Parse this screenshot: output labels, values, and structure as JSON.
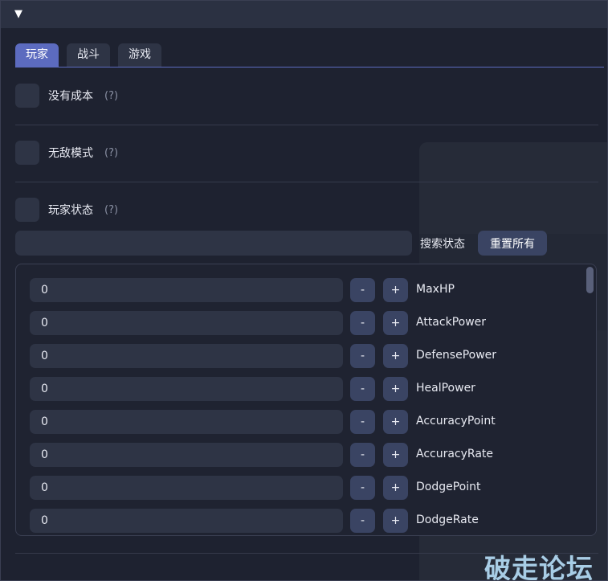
{
  "window": {
    "collapse_glyph": "▼"
  },
  "tabs": [
    {
      "label": "玩家",
      "active": true
    },
    {
      "label": "战斗",
      "active": false
    },
    {
      "label": "游戏",
      "active": false
    }
  ],
  "options": [
    {
      "label": "没有成本",
      "help": "(?)"
    },
    {
      "label": "无敌模式",
      "help": "(?)"
    },
    {
      "label": "玩家状态",
      "help": "(?)"
    }
  ],
  "search": {
    "value": "",
    "label": "搜索状态",
    "reset_label": "重置所有"
  },
  "stats": [
    {
      "value": "0",
      "name": "MaxHP"
    },
    {
      "value": "0",
      "name": "AttackPower"
    },
    {
      "value": "0",
      "name": "DefensePower"
    },
    {
      "value": "0",
      "name": "HealPower"
    },
    {
      "value": "0",
      "name": "AccuracyPoint"
    },
    {
      "value": "0",
      "name": "AccuracyRate"
    },
    {
      "value": "0",
      "name": "DodgePoint"
    },
    {
      "value": "0",
      "name": "DodgeRate"
    }
  ],
  "stepper": {
    "minus": "-",
    "plus": "+"
  },
  "watermark": "破走论坛"
}
